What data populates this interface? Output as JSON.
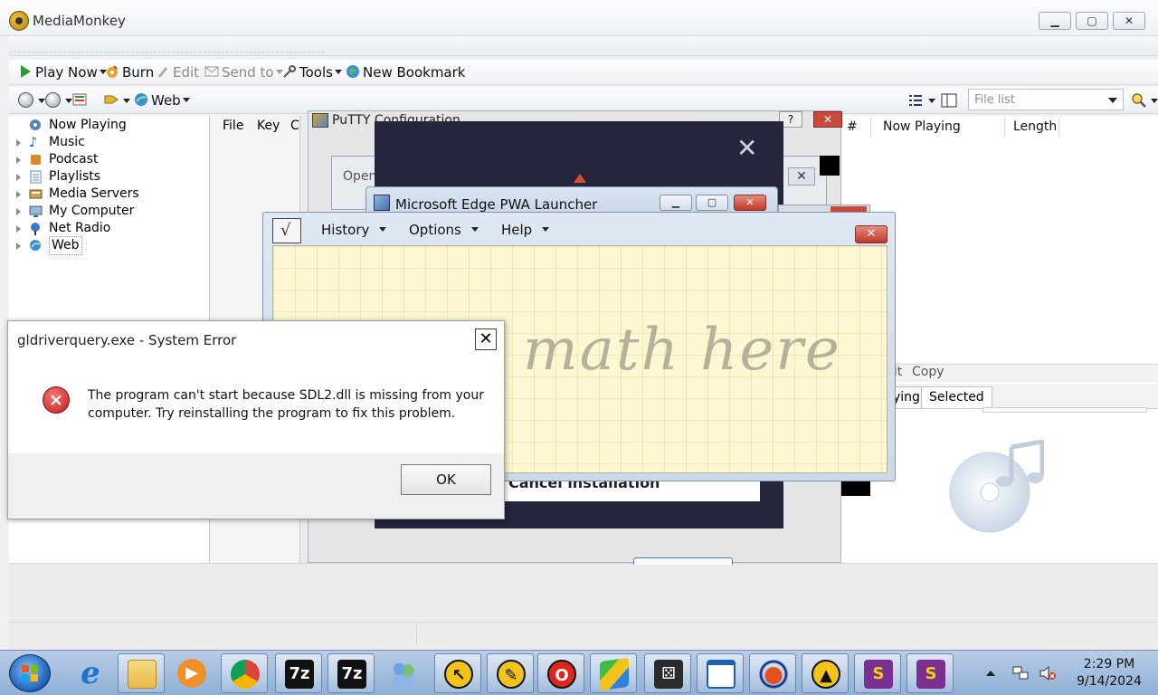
{
  "app": {
    "title": "MediaMonkey"
  },
  "toolbar1": {
    "play_now": "Play Now",
    "burn": "Burn",
    "edit": "Edit",
    "send_to": "Send to",
    "tools": "Tools",
    "new_bookmark": "New Bookmark"
  },
  "toolbar2": {
    "web": "Web",
    "filelist_placeholder": "File list"
  },
  "tree": {
    "items": [
      {
        "label": "Now Playing",
        "icon": "now-playing-icon"
      },
      {
        "label": "Music",
        "icon": "music-note-icon"
      },
      {
        "label": "Podcast",
        "icon": "podcast-icon"
      },
      {
        "label": "Playlists",
        "icon": "playlist-icon"
      },
      {
        "label": "Media Servers",
        "icon": "media-server-icon"
      },
      {
        "label": "My Computer",
        "icon": "computer-icon"
      },
      {
        "label": "Net Radio",
        "icon": "net-radio-icon"
      },
      {
        "label": "Web",
        "icon": "globe-icon"
      }
    ]
  },
  "midpane": {
    "file": "File",
    "key": "Key",
    "c": "C"
  },
  "nowplaying": {
    "col_num": "#",
    "col_now_playing": "Now Playing",
    "col_length": "Length",
    "edit_frag": "lit",
    "copy": "Copy",
    "tab_playing": "ying",
    "tab_selected": "Selected"
  },
  "putty": {
    "title": "PuTTY Configuration",
    "help": "?",
    "close": "✕"
  },
  "open_dialog": {
    "label": "Open",
    "close": "✕"
  },
  "installer": {
    "close": "✕",
    "cancel": "Cancel installation"
  },
  "edgepwa": {
    "title": "Microsoft Edge PWA Launcher",
    "min": "▁",
    "max": "▢",
    "close": "✕"
  },
  "mathpanel": {
    "menu": [
      "History",
      "Options",
      "Help"
    ],
    "close": "✕",
    "hint": "math here"
  },
  "error": {
    "title": "gldriverquery.exe - System Error",
    "close": "✕",
    "icon": "×",
    "message": "The program can't start because SDL2.dll is missing from your computer. Try reinstalling the program to fix this problem.",
    "ok": "OK"
  },
  "taskbar": {
    "apps": [
      {
        "name": "ie-icon",
        "glyph": "e",
        "fg": "#1e73d1",
        "bg": "transparent"
      },
      {
        "name": "file-explorer-icon",
        "glyph": "",
        "fg": "#c99a2e",
        "bg": "#f2cf63"
      },
      {
        "name": "media-player-icon",
        "glyph": "▶",
        "fg": "#ffffff",
        "bg": "#f0902a"
      },
      {
        "name": "chrome-icon",
        "glyph": "",
        "fg": "#ffffff",
        "bg": "transparent"
      },
      {
        "name": "7zip-icon",
        "glyph": "7z",
        "fg": "#ffffff",
        "bg": "#111111"
      },
      {
        "name": "7zip-icon-2",
        "glyph": "7z",
        "fg": "#ffffff",
        "bg": "#111111"
      },
      {
        "name": "users-icon",
        "glyph": "",
        "fg": "#3a6fb0",
        "bg": "transparent"
      },
      {
        "name": "cursor-tool-icon",
        "glyph": "↖",
        "fg": "#111111",
        "bg": "#f2c318"
      },
      {
        "name": "pencil-tool-icon",
        "glyph": "✎",
        "fg": "#111111",
        "bg": "#f2c318"
      },
      {
        "name": "opera-icon",
        "glyph": "O",
        "fg": "#ffffff",
        "bg": "#e0261b"
      },
      {
        "name": "bluestacks-icon",
        "glyph": "",
        "fg": "#ffffff",
        "bg": "transparent"
      },
      {
        "name": "dice-icon",
        "glyph": "⚄",
        "fg": "#ffffff",
        "bg": "#2b2b2b"
      },
      {
        "name": "window-icon",
        "glyph": "",
        "fg": "#1d5fb3",
        "bg": "#ffffff"
      },
      {
        "name": "audacity-icon",
        "glyph": "",
        "fg": "#e2521f",
        "bg": "transparent"
      },
      {
        "name": "vlc-like-icon",
        "glyph": "▲",
        "fg": "#111111",
        "bg": "#f2c318"
      },
      {
        "name": "s-app-icon",
        "glyph": "S",
        "fg": "#f4d10f",
        "bg": "#7b2f93"
      },
      {
        "name": "s-app-icon-2",
        "glyph": "S",
        "fg": "#f4d10f",
        "bg": "#7b2f93"
      }
    ],
    "clock_time": "2:29 PM",
    "clock_date": "9/14/2024"
  },
  "colors": {
    "taskbar": "#a5bfe0",
    "error_red": "#c41919",
    "close_red": "#c2392a",
    "math_paper": "#fdf7d3",
    "installer_bg": "#25263e"
  }
}
